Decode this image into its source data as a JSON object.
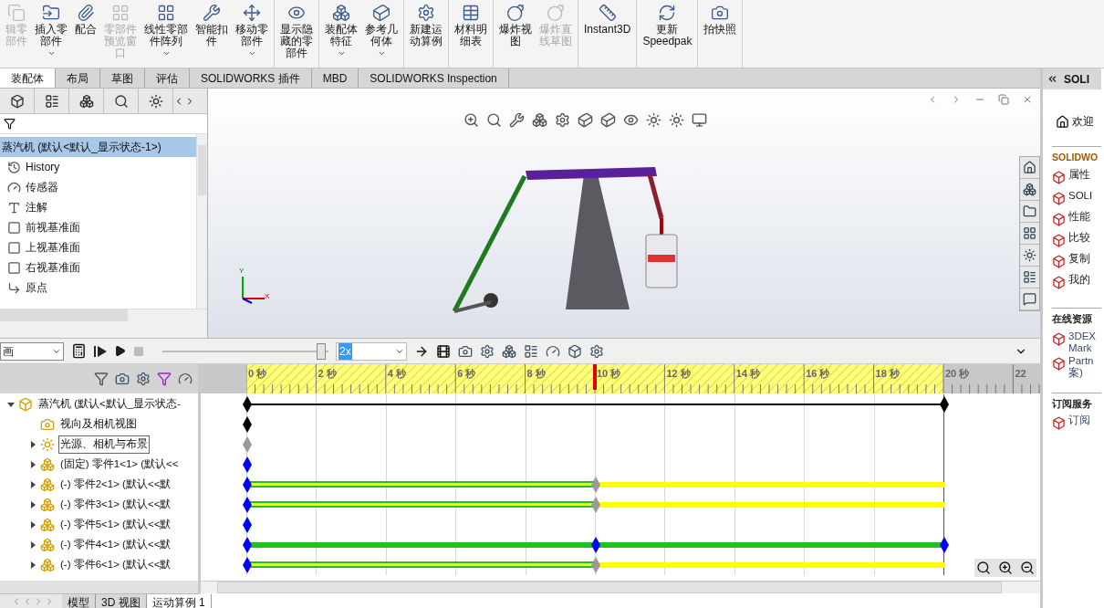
{
  "toolbar": {
    "groups": [
      [
        {
          "lines": [
            "辑零",
            "部件"
          ],
          "disabled": true,
          "caret": false
        },
        {
          "lines": [
            "插入零",
            "部件"
          ],
          "disabled": false,
          "caret": true
        },
        {
          "lines": [
            "配合"
          ],
          "disabled": false,
          "caret": false
        },
        {
          "lines": [
            "零部件",
            "预览窗",
            "口"
          ],
          "disabled": true,
          "caret": false
        },
        {
          "lines": [
            "线性零部",
            "件阵列"
          ],
          "disabled": false,
          "caret": true
        },
        {
          "lines": [
            "智能扣",
            "件"
          ],
          "disabled": false,
          "caret": false
        },
        {
          "lines": [
            "移动零",
            "部件"
          ],
          "disabled": false,
          "caret": true
        }
      ],
      [
        {
          "lines": [
            "显示隐",
            "藏的零",
            "部件"
          ],
          "disabled": false,
          "caret": false
        }
      ],
      [
        {
          "lines": [
            "装配体",
            "特征"
          ],
          "disabled": false,
          "caret": true
        },
        {
          "lines": [
            "参考几",
            "何体"
          ],
          "disabled": false,
          "caret": true
        }
      ],
      [
        {
          "lines": [
            "新建运",
            "动算例"
          ],
          "disabled": false,
          "caret": false
        }
      ],
      [
        {
          "lines": [
            "材料明",
            "细表"
          ],
          "disabled": false,
          "caret": false
        }
      ],
      [
        {
          "lines": [
            "爆炸视",
            "图"
          ],
          "disabled": false,
          "caret": false
        },
        {
          "lines": [
            "爆炸直",
            "线草图"
          ],
          "disabled": true,
          "caret": false
        }
      ],
      [
        {
          "lines": [
            "Instant3D"
          ],
          "disabled": false,
          "caret": false
        }
      ],
      [
        {
          "lines": [
            "更新",
            "Speedpak"
          ],
          "disabled": false,
          "caret": false
        }
      ],
      [
        {
          "lines": [
            "拍快照"
          ],
          "disabled": false,
          "caret": false
        }
      ]
    ]
  },
  "tabs": [
    {
      "label": "装配体",
      "selected": true
    },
    {
      "label": "布局",
      "selected": false
    },
    {
      "label": "草图",
      "selected": false
    },
    {
      "label": "评估",
      "selected": false
    },
    {
      "label": "SOLIDWORKS 插件",
      "selected": false
    },
    {
      "label": "MBD",
      "selected": false
    },
    {
      "label": "SOLIDWORKS Inspection",
      "selected": false
    }
  ],
  "feature_tree": {
    "root": {
      "label": "蒸汽机 (默认<默认_显示状态-1>)",
      "selected": true
    },
    "items": [
      {
        "label": "History",
        "kind": "history"
      },
      {
        "label": "传感器",
        "kind": "sensor"
      },
      {
        "label": "注解",
        "kind": "annotation"
      },
      {
        "label": "前视基准面",
        "kind": "plane"
      },
      {
        "label": "上视基准面",
        "kind": "plane"
      },
      {
        "label": "右视基准面",
        "kind": "plane"
      },
      {
        "label": "原点",
        "kind": "origin"
      }
    ]
  },
  "viewport": {
    "axes": [
      "Y",
      "X"
    ]
  },
  "task_pane": {
    "title": "SOLI",
    "welcome": "欢迎",
    "sections": [
      {
        "title": "SOLIDWO",
        "kind": "brand",
        "items": [
          {
            "lines": [
              "属性"
            ]
          },
          {
            "lines": [
              "SOLI"
            ]
          },
          {
            "lines": [
              "性能"
            ]
          },
          {
            "lines": [
              "比较"
            ]
          },
          {
            "lines": [
              "复制"
            ]
          },
          {
            "lines": [
              "我的"
            ]
          }
        ]
      },
      {
        "title": "在线资源",
        "kind": "plain",
        "items": [
          {
            "lines": [
              "3DEX",
              "Mark"
            ]
          },
          {
            "lines": [
              "Partn",
              "案)"
            ]
          }
        ]
      },
      {
        "title": "订阅服务",
        "kind": "plain",
        "items": [
          {
            "lines": [
              "订阅"
            ]
          }
        ]
      }
    ]
  },
  "motion": {
    "study_type": "画",
    "playback": {
      "level": 0.98
    },
    "speed": "2x",
    "ruler": {
      "labels": [
        "0 秒",
        "2 秒",
        "4 秒",
        "6 秒",
        "8 秒",
        "10 秒",
        "12 秒",
        "14 秒",
        "16 秒",
        "18 秒",
        "20 秒",
        "22"
      ]
    },
    "time_bar": {
      "level": 0.5
    },
    "rows": [
      {
        "label": "蒸汽机 (默认<默认_显示状态-",
        "expanded": true,
        "kind": "assembly",
        "focused": false,
        "keys": [
          {
            "level": 0,
            "color": "#000000"
          },
          {
            "level": 1,
            "color": "#000000"
          }
        ],
        "bars": [
          {
            "kind": "line"
          }
        ]
      },
      {
        "label": "视向及相机视图",
        "kind": "camera",
        "focused": false,
        "keys": [
          {
            "level": 0,
            "color": "#000000"
          }
        ],
        "bars": []
      },
      {
        "label": "光源、相机与布景",
        "expanded": false,
        "kind": "lights",
        "focused": true,
        "keys": [
          {
            "level": 0,
            "color": "#999999"
          }
        ],
        "bars": []
      },
      {
        "label": "(固定) 零件1<1> (默认<<",
        "expanded": false,
        "kind": "part",
        "focused": false,
        "keys": [
          {
            "level": 0,
            "color": "#0000ff"
          }
        ],
        "bars": []
      },
      {
        "label": "(-) 零件2<1> (默认<<默",
        "expanded": false,
        "kind": "part",
        "focused": false,
        "keys": [
          {
            "level": 0,
            "color": "#0000ff"
          },
          {
            "level": 0.5,
            "color": "#999999"
          }
        ],
        "bars": [
          {
            "kind": "change"
          },
          {
            "kind": "hold"
          }
        ]
      },
      {
        "label": "(-) 零件3<1> (默认<<默",
        "expanded": false,
        "kind": "part",
        "focused": false,
        "keys": [
          {
            "level": 0,
            "color": "#0000ff"
          },
          {
            "level": 0.5,
            "color": "#999999"
          }
        ],
        "bars": [
          {
            "kind": "change"
          },
          {
            "kind": "hold"
          }
        ]
      },
      {
        "label": "(-) 零件5<1> (默认<<默",
        "expanded": false,
        "kind": "part",
        "focused": false,
        "keys": [
          {
            "level": 0,
            "color": "#0000ff"
          }
        ],
        "bars": []
      },
      {
        "label": "(-) 零件4<1> (默认<<默",
        "expanded": false,
        "kind": "part",
        "focused": false,
        "keys": [
          {
            "level": 0,
            "color": "#0000ff"
          },
          {
            "level": 0.5,
            "color": "#0000ff"
          },
          {
            "level": 1,
            "color": "#0000ff"
          }
        ],
        "bars": [
          {
            "kind": "motion"
          },
          {
            "kind": "motion"
          }
        ]
      },
      {
        "label": "(-) 零件6<1> (默认<<默",
        "expanded": false,
        "kind": "part",
        "focused": false,
        "keys": [
          {
            "level": 0,
            "color": "#0000ff"
          },
          {
            "level": 0.5,
            "color": "#999999"
          }
        ],
        "bars": [
          {
            "kind": "change"
          },
          {
            "kind": "hold"
          }
        ]
      }
    ]
  },
  "bottom_tabs": [
    {
      "label": "模型",
      "selected": false
    },
    {
      "label": "3D 视图",
      "selected": false
    },
    {
      "label": "运动算例 1",
      "selected": true
    }
  ]
}
